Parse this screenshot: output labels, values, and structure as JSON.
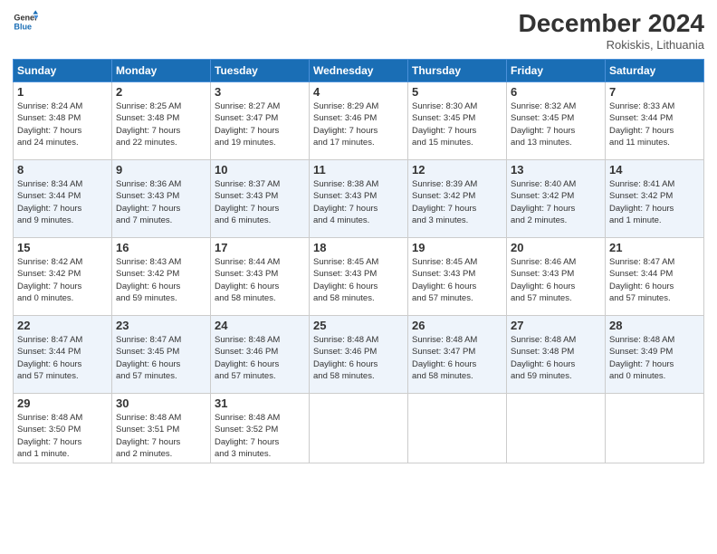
{
  "logo": {
    "line1": "General",
    "line2": "Blue"
  },
  "title": "December 2024",
  "location": "Rokiskis, Lithuania",
  "days_of_week": [
    "Sunday",
    "Monday",
    "Tuesday",
    "Wednesday",
    "Thursday",
    "Friday",
    "Saturday"
  ],
  "weeks": [
    [
      {
        "day": "1",
        "sunrise": "8:24 AM",
        "sunset": "3:48 PM",
        "daylight": "7 hours and 24 minutes."
      },
      {
        "day": "2",
        "sunrise": "8:25 AM",
        "sunset": "3:48 PM",
        "daylight": "7 hours and 22 minutes."
      },
      {
        "day": "3",
        "sunrise": "8:27 AM",
        "sunset": "3:47 PM",
        "daylight": "7 hours and 19 minutes."
      },
      {
        "day": "4",
        "sunrise": "8:29 AM",
        "sunset": "3:46 PM",
        "daylight": "7 hours and 17 minutes."
      },
      {
        "day": "5",
        "sunrise": "8:30 AM",
        "sunset": "3:45 PM",
        "daylight": "7 hours and 15 minutes."
      },
      {
        "day": "6",
        "sunrise": "8:32 AM",
        "sunset": "3:45 PM",
        "daylight": "7 hours and 13 minutes."
      },
      {
        "day": "7",
        "sunrise": "8:33 AM",
        "sunset": "3:44 PM",
        "daylight": "7 hours and 11 minutes."
      }
    ],
    [
      {
        "day": "8",
        "sunrise": "8:34 AM",
        "sunset": "3:44 PM",
        "daylight": "7 hours and 9 minutes."
      },
      {
        "day": "9",
        "sunrise": "8:36 AM",
        "sunset": "3:43 PM",
        "daylight": "7 hours and 7 minutes."
      },
      {
        "day": "10",
        "sunrise": "8:37 AM",
        "sunset": "3:43 PM",
        "daylight": "7 hours and 6 minutes."
      },
      {
        "day": "11",
        "sunrise": "8:38 AM",
        "sunset": "3:43 PM",
        "daylight": "7 hours and 4 minutes."
      },
      {
        "day": "12",
        "sunrise": "8:39 AM",
        "sunset": "3:42 PM",
        "daylight": "7 hours and 3 minutes."
      },
      {
        "day": "13",
        "sunrise": "8:40 AM",
        "sunset": "3:42 PM",
        "daylight": "7 hours and 2 minutes."
      },
      {
        "day": "14",
        "sunrise": "8:41 AM",
        "sunset": "3:42 PM",
        "daylight": "7 hours and 1 minute."
      }
    ],
    [
      {
        "day": "15",
        "sunrise": "8:42 AM",
        "sunset": "3:42 PM",
        "daylight": "7 hours and 0 minutes."
      },
      {
        "day": "16",
        "sunrise": "8:43 AM",
        "sunset": "3:42 PM",
        "daylight": "6 hours and 59 minutes."
      },
      {
        "day": "17",
        "sunrise": "8:44 AM",
        "sunset": "3:43 PM",
        "daylight": "6 hours and 58 minutes."
      },
      {
        "day": "18",
        "sunrise": "8:45 AM",
        "sunset": "3:43 PM",
        "daylight": "6 hours and 58 minutes."
      },
      {
        "day": "19",
        "sunrise": "8:45 AM",
        "sunset": "3:43 PM",
        "daylight": "6 hours and 57 minutes."
      },
      {
        "day": "20",
        "sunrise": "8:46 AM",
        "sunset": "3:43 PM",
        "daylight": "6 hours and 57 minutes."
      },
      {
        "day": "21",
        "sunrise": "8:47 AM",
        "sunset": "3:44 PM",
        "daylight": "6 hours and 57 minutes."
      }
    ],
    [
      {
        "day": "22",
        "sunrise": "8:47 AM",
        "sunset": "3:44 PM",
        "daylight": "6 hours and 57 minutes."
      },
      {
        "day": "23",
        "sunrise": "8:47 AM",
        "sunset": "3:45 PM",
        "daylight": "6 hours and 57 minutes."
      },
      {
        "day": "24",
        "sunrise": "8:48 AM",
        "sunset": "3:46 PM",
        "daylight": "6 hours and 57 minutes."
      },
      {
        "day": "25",
        "sunrise": "8:48 AM",
        "sunset": "3:46 PM",
        "daylight": "6 hours and 58 minutes."
      },
      {
        "day": "26",
        "sunrise": "8:48 AM",
        "sunset": "3:47 PM",
        "daylight": "6 hours and 58 minutes."
      },
      {
        "day": "27",
        "sunrise": "8:48 AM",
        "sunset": "3:48 PM",
        "daylight": "6 hours and 59 minutes."
      },
      {
        "day": "28",
        "sunrise": "8:48 AM",
        "sunset": "3:49 PM",
        "daylight": "7 hours and 0 minutes."
      }
    ],
    [
      {
        "day": "29",
        "sunrise": "8:48 AM",
        "sunset": "3:50 PM",
        "daylight": "7 hours and 1 minute."
      },
      {
        "day": "30",
        "sunrise": "8:48 AM",
        "sunset": "3:51 PM",
        "daylight": "7 hours and 2 minutes."
      },
      {
        "day": "31",
        "sunrise": "8:48 AM",
        "sunset": "3:52 PM",
        "daylight": "7 hours and 3 minutes."
      },
      null,
      null,
      null,
      null
    ]
  ]
}
